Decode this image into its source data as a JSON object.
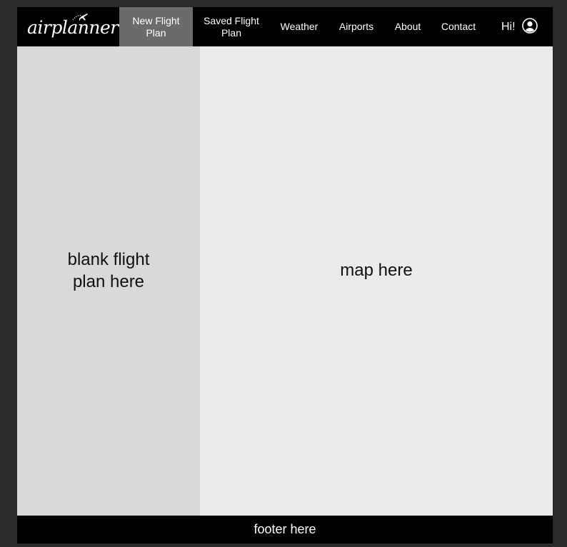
{
  "header": {
    "logo_text": "airplanner",
    "nav": [
      {
        "label": "New Flight\nPlan",
        "active": true
      },
      {
        "label": "Saved Flight\nPlan",
        "active": false
      },
      {
        "label": "Weather",
        "active": false
      },
      {
        "label": "Airports",
        "active": false
      },
      {
        "label": "About",
        "active": false
      },
      {
        "label": "Contact",
        "active": false
      }
    ],
    "greeting": "Hi!",
    "user_icon": "user-circle-icon"
  },
  "main": {
    "flight_plan_placeholder": "blank flight\nplan here",
    "map_placeholder": "map here"
  },
  "footer": {
    "text": "footer here"
  },
  "colors": {
    "active_nav": "#6b6b6b",
    "left_panel": "#d9d9d9",
    "right_panel": "#ebebeb",
    "bar": "#000000"
  }
}
